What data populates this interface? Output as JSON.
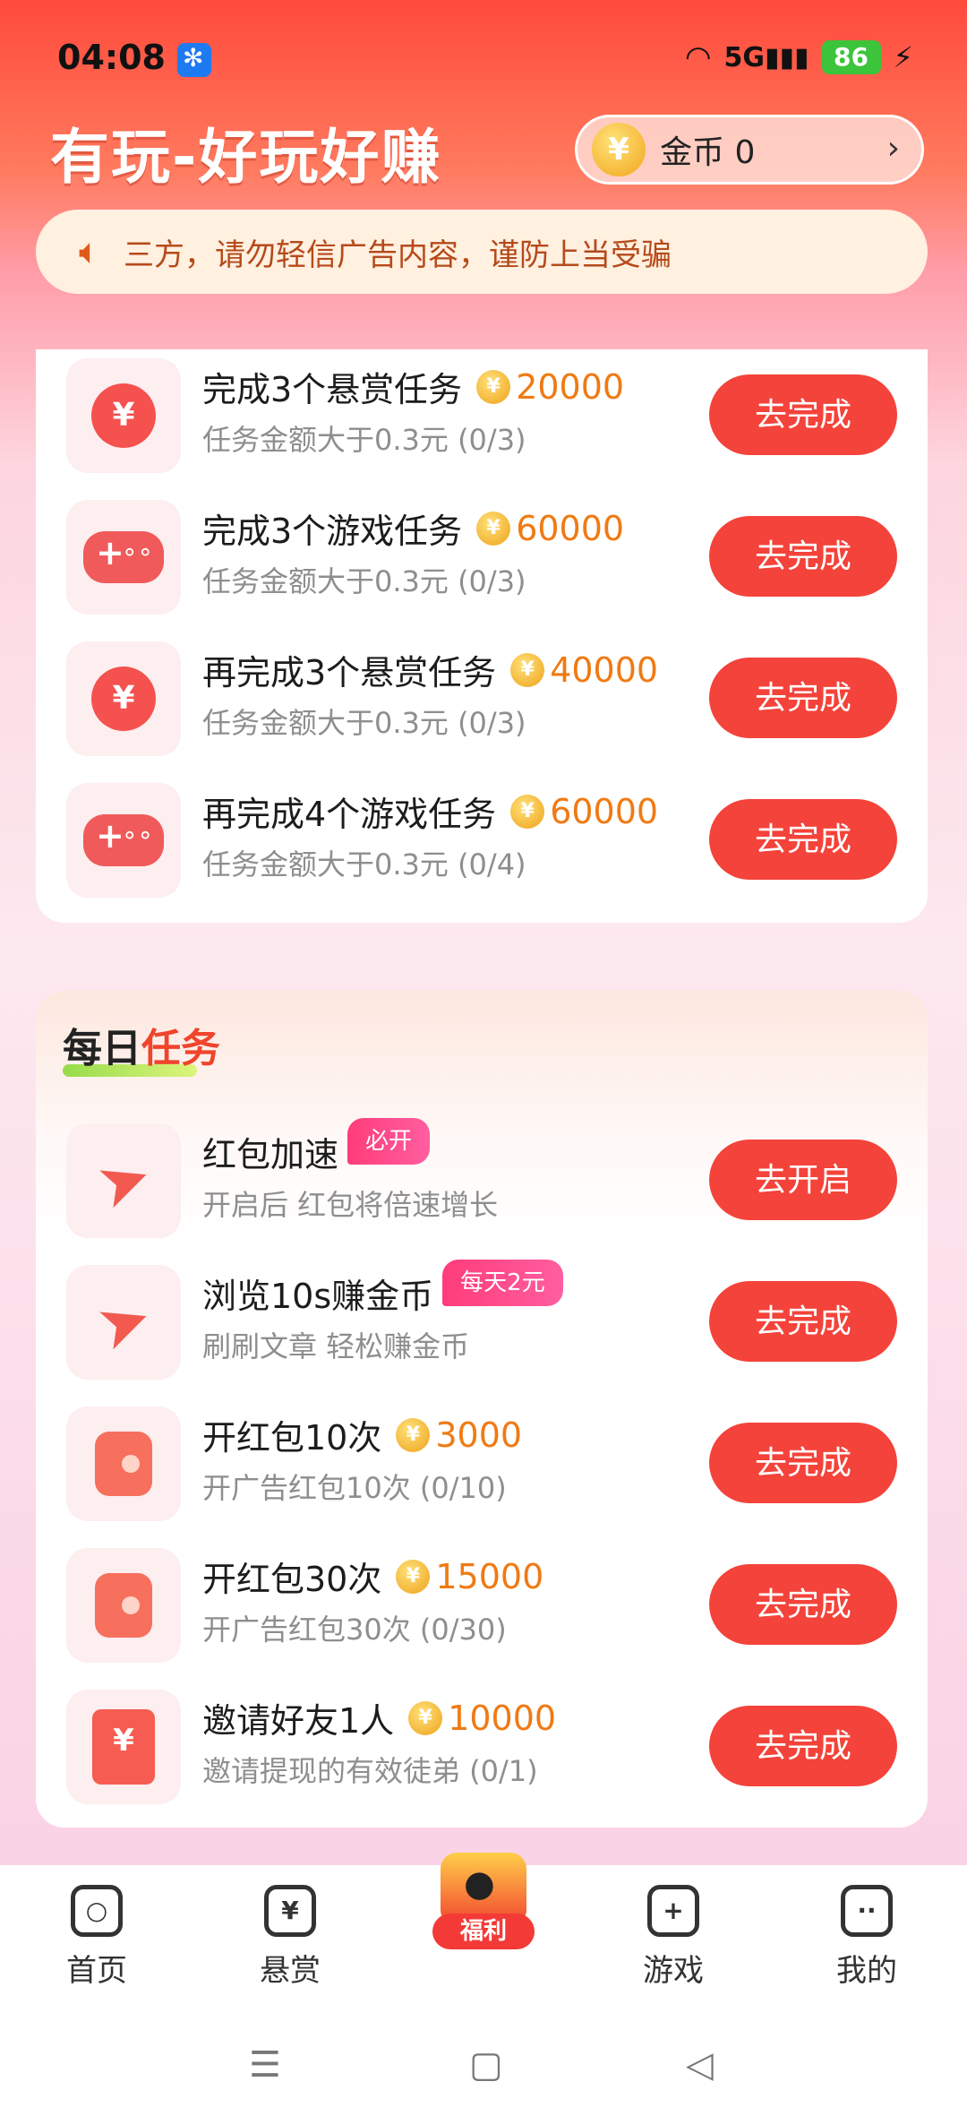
{
  "status": {
    "time": "04:08",
    "signal": "5G",
    "battery": "86"
  },
  "header": {
    "title": "有玩-好玩好赚",
    "coin_label": "金币 0"
  },
  "notice": {
    "text": "三方，请勿轻信广告内容，谨防上当受骗"
  },
  "tasks_top": [
    {
      "title": "完成3个悬赏任务",
      "reward": "20000",
      "sub": "任务金额大于0.3元 (0/3)",
      "button": "去完成",
      "icon": "yen-coin-icon"
    },
    {
      "title": "完成3个游戏任务",
      "reward": "60000",
      "sub": "任务金额大于0.3元 (0/3)",
      "button": "去完成",
      "icon": "gamepad-icon"
    },
    {
      "title": "再完成3个悬赏任务",
      "reward": "40000",
      "sub": "任务金额大于0.3元 (0/3)",
      "button": "去完成",
      "icon": "yen-coin-icon"
    },
    {
      "title": "再完成4个游戏任务",
      "reward": "60000",
      "sub": "任务金额大于0.3元 (0/4)",
      "button": "去完成",
      "icon": "gamepad-icon"
    }
  ],
  "daily": {
    "title_a": "每日",
    "title_b": "任务",
    "items": [
      {
        "title": "红包加速",
        "tag": "必开",
        "sub": "开启后 红包将倍速增长",
        "button": "去开启",
        "icon": "paper-plane-icon"
      },
      {
        "title": "浏览10s赚金币",
        "tag": "每天2元",
        "sub": "刷刷文章 轻松赚金币",
        "button": "去完成",
        "icon": "paper-plane-icon"
      },
      {
        "title": "开红包10次",
        "reward": "3000",
        "sub": "开广告红包10次 (0/10)",
        "button": "去完成",
        "icon": "wallet-icon"
      },
      {
        "title": "开红包30次",
        "reward": "15000",
        "sub": "开广告红包30次 (0/30)",
        "button": "去完成",
        "icon": "wallet-icon"
      },
      {
        "title": "邀请好友1人",
        "reward": "10000",
        "sub": "邀请提现的有效徒弟 (0/1)",
        "button": "去完成",
        "icon": "red-envelope-icon"
      }
    ]
  },
  "nav": {
    "home": "首页",
    "bounty": "悬赏",
    "welfare": "福利",
    "games": "游戏",
    "mine": "我的"
  }
}
